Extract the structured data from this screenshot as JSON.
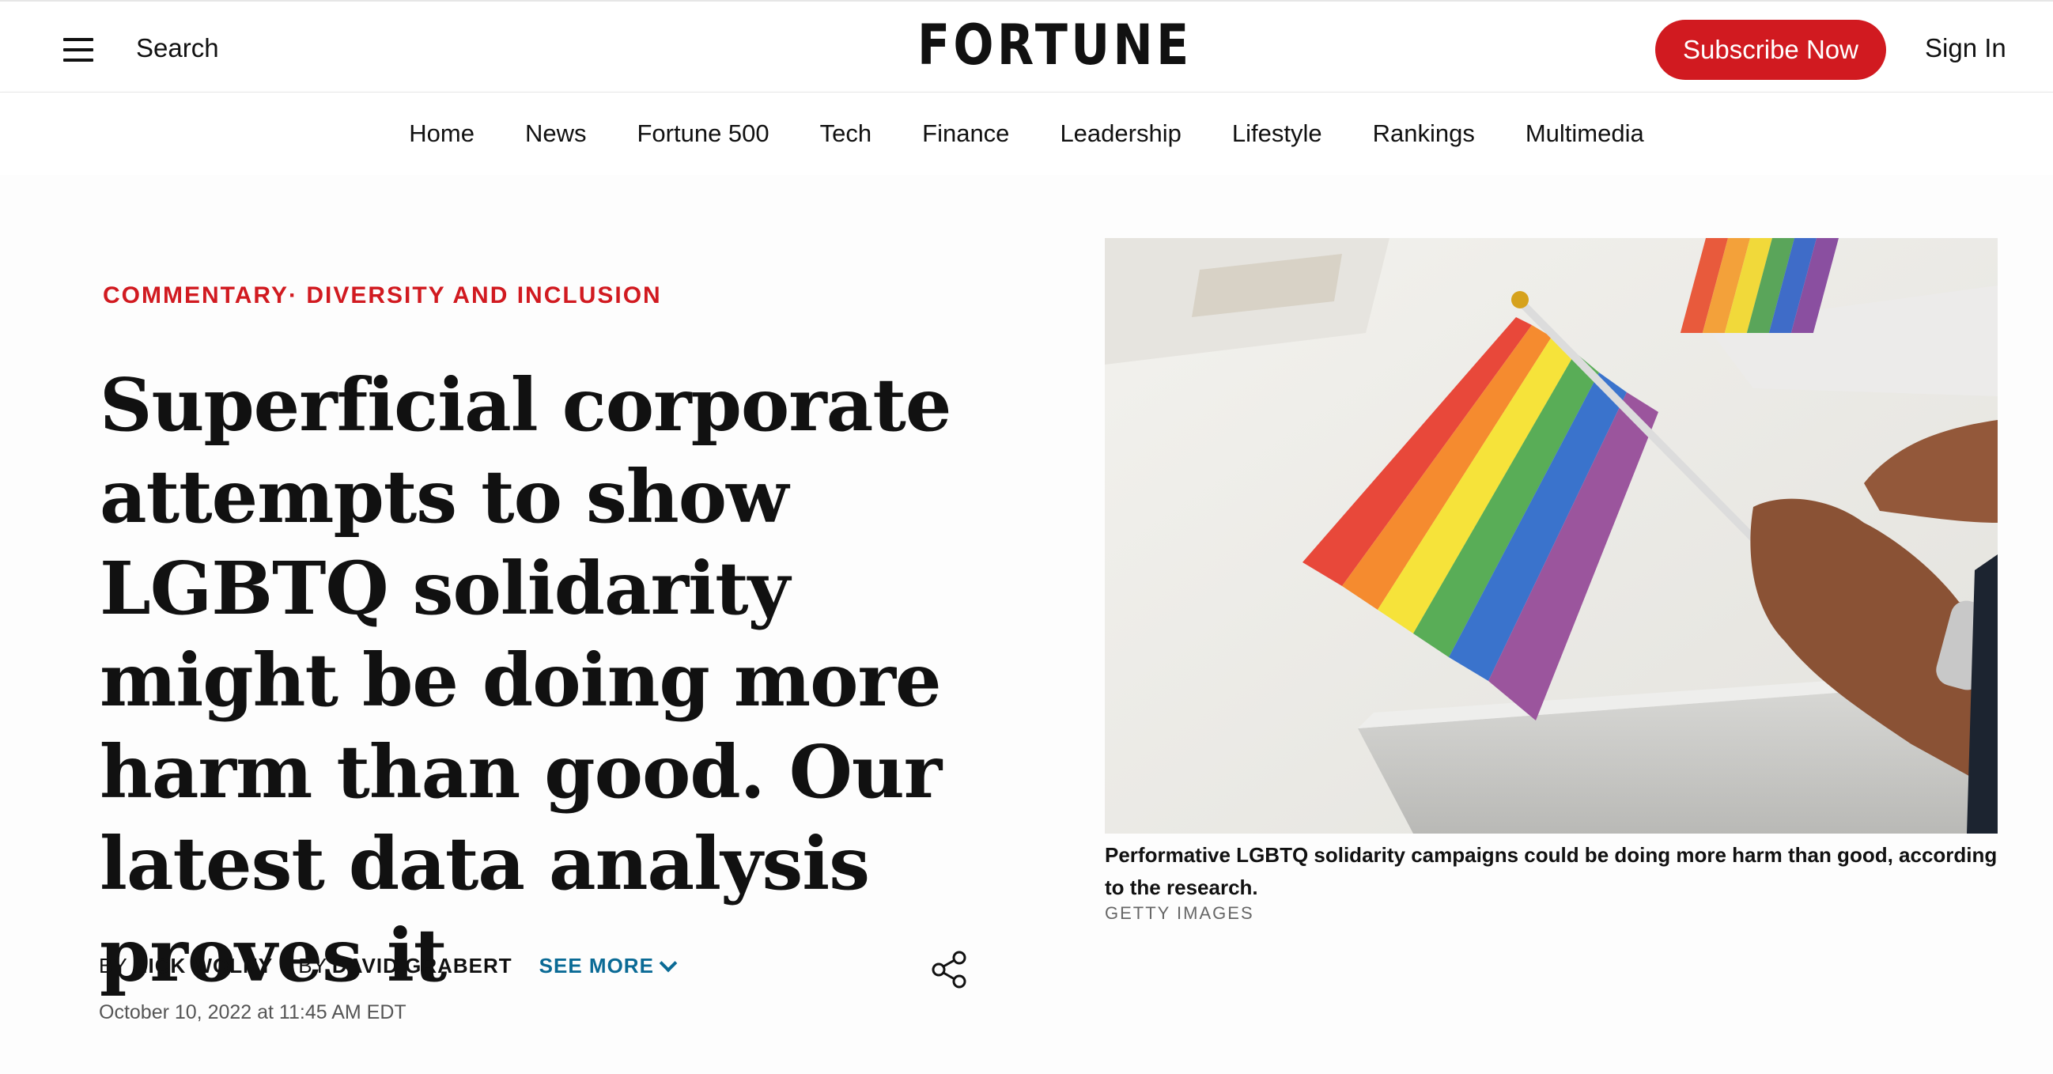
{
  "header": {
    "search_label": "Search",
    "logo_text": "FORTUNE",
    "subscribe_label": "Subscribe Now",
    "signin_label": "Sign In",
    "brand_color": "#d11a20"
  },
  "nav": {
    "items": [
      "Home",
      "News",
      "Fortune 500",
      "Tech",
      "Finance",
      "Leadership",
      "Lifestyle",
      "Rankings",
      "Multimedia"
    ]
  },
  "article": {
    "category_primary": "COMMENTARY",
    "category_separator": "·",
    "category_secondary": "DIVERSITY AND INCLUSION",
    "headline": "Superficial corporate attempts to show LGBTQ solidarity might be doing more harm than good. Our latest data analysis proves it",
    "by_label": "BY",
    "authors": [
      "NICK WOLNY",
      "DAVID GRABERT"
    ],
    "see_more_label": "SEE MORE",
    "date": "October 10, 2022 at 11:45 AM EDT"
  },
  "image": {
    "caption": "Performative LGBTQ solidarity campaigns could be doing more harm than good, according to the research.",
    "credit": "GETTY IMAGES"
  }
}
